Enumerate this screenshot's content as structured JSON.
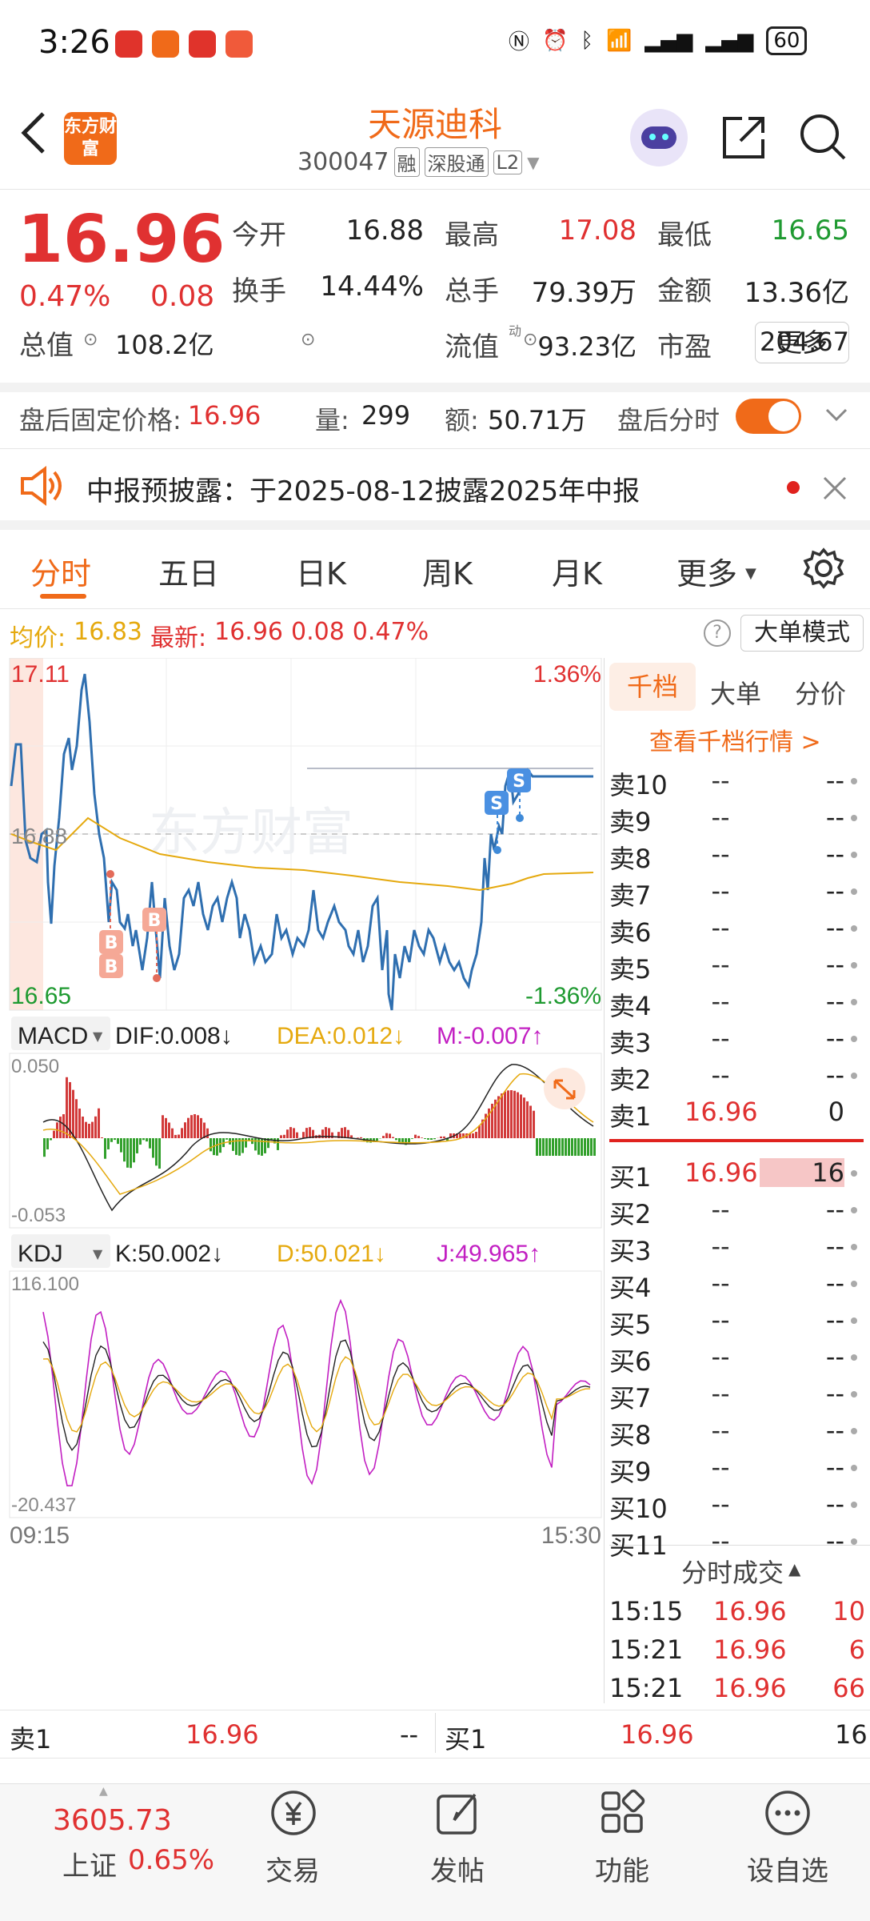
{
  "status_bar": {
    "time": "3:26",
    "battery": "60"
  },
  "header": {
    "logo": "东方财富",
    "title": "天源迪科",
    "code": "300047",
    "tags": [
      "融",
      "深股通",
      "L2"
    ]
  },
  "quote": {
    "price": "16.96",
    "change_pct": "0.47%",
    "change": "0.08",
    "stats": [
      {
        "label": "今开",
        "value": "16.88",
        "color": "#222"
      },
      {
        "label": "最高",
        "value": "17.08",
        "color": "#e03131"
      },
      {
        "label": "最低",
        "value": "16.65",
        "color": "#1f9a31"
      },
      {
        "label": "换手",
        "value": "14.44%",
        "color": "#222"
      },
      {
        "label": "总手",
        "value": "79.39万",
        "color": "#222"
      },
      {
        "label": "金额",
        "value": "13.36亿",
        "color": "#222"
      },
      {
        "label": "总值",
        "value": "108.2亿",
        "color": "#222"
      },
      {
        "label": "流值",
        "value": "93.23亿",
        "color": "#222"
      },
      {
        "label": "市盈",
        "value": "204.67",
        "color": "#222"
      }
    ],
    "pe_sup": "动",
    "more_btn": "更多"
  },
  "after_hours": {
    "label": "盘后固定价格:",
    "price": "16.96",
    "vol_label": "量:",
    "vol": "299",
    "amt_label": "额:",
    "amt": "50.71万",
    "toggle_label": "盘后分时"
  },
  "notice": {
    "text": "中报预披露：于2025-08-12披露2025年中报"
  },
  "tabs": [
    "分时",
    "五日",
    "日K",
    "周K",
    "月K",
    "更多"
  ],
  "avg_line": {
    "avg_label": "均价:",
    "avg": "16.83",
    "latest_label": "最新:",
    "latest": "16.96",
    "chg": "0.08",
    "pct": "0.47%",
    "mode_btn": "大单模式"
  },
  "chart_labels": {
    "high": "17.11",
    "low": "16.65",
    "pre_close": "16.88",
    "high_pct": "1.36%",
    "low_pct": "-1.36%",
    "watermark": "东方财富",
    "start": "09:15",
    "end": "15:30"
  },
  "macd": {
    "name": "MACD",
    "dif": "DIF:0.008↓",
    "dea": "DEA:0.012↓",
    "m": "M:-0.007↑",
    "top": "0.050",
    "bottom": "-0.053"
  },
  "kdj": {
    "name": "KDJ",
    "k": "K:50.002↓",
    "d": "D:50.021↓",
    "j": "J:49.965↑",
    "top": "116.100",
    "bottom": "-20.437"
  },
  "book": {
    "tabs": [
      "千档",
      "大单",
      "分价"
    ],
    "link": "查看千档行情 >",
    "asks": [
      {
        "l": "卖10",
        "p": "--",
        "v": "--"
      },
      {
        "l": "卖9",
        "p": "--",
        "v": "--"
      },
      {
        "l": "卖8",
        "p": "--",
        "v": "--"
      },
      {
        "l": "卖7",
        "p": "--",
        "v": "--"
      },
      {
        "l": "卖6",
        "p": "--",
        "v": "--"
      },
      {
        "l": "卖5",
        "p": "--",
        "v": "--"
      },
      {
        "l": "卖4",
        "p": "--",
        "v": "--"
      },
      {
        "l": "卖3",
        "p": "--",
        "v": "--"
      },
      {
        "l": "卖2",
        "p": "--",
        "v": "--"
      },
      {
        "l": "卖1",
        "p": "16.96",
        "v": "0"
      }
    ],
    "bids": [
      {
        "l": "买1",
        "p": "16.96",
        "v": "16"
      },
      {
        "l": "买2",
        "p": "--",
        "v": "--"
      },
      {
        "l": "买3",
        "p": "--",
        "v": "--"
      },
      {
        "l": "买4",
        "p": "--",
        "v": "--"
      },
      {
        "l": "买5",
        "p": "--",
        "v": "--"
      },
      {
        "l": "买6",
        "p": "--",
        "v": "--"
      },
      {
        "l": "买7",
        "p": "--",
        "v": "--"
      },
      {
        "l": "买8",
        "p": "--",
        "v": "--"
      },
      {
        "l": "买9",
        "p": "--",
        "v": "--"
      },
      {
        "l": "买10",
        "p": "--",
        "v": "--"
      },
      {
        "l": "买11",
        "p": "--",
        "v": "--"
      }
    ],
    "trades_title": "分时成交",
    "trades": [
      {
        "t": "15:15",
        "p": "16.96",
        "v": "10"
      },
      {
        "t": "15:21",
        "p": "16.96",
        "v": "6"
      },
      {
        "t": "15:21",
        "p": "16.96",
        "v": "66"
      }
    ]
  },
  "bottom_quote": {
    "sell_label": "卖1",
    "sell_price": "16.96",
    "sell_vol": "--",
    "buy_label": "买1",
    "buy_price": "16.96",
    "buy_vol": "16"
  },
  "nav": {
    "index_value": "3605.73",
    "index_name": "上证",
    "index_pct": "0.65%",
    "items": [
      "交易",
      "发帖",
      "功能",
      "设自选"
    ]
  }
}
